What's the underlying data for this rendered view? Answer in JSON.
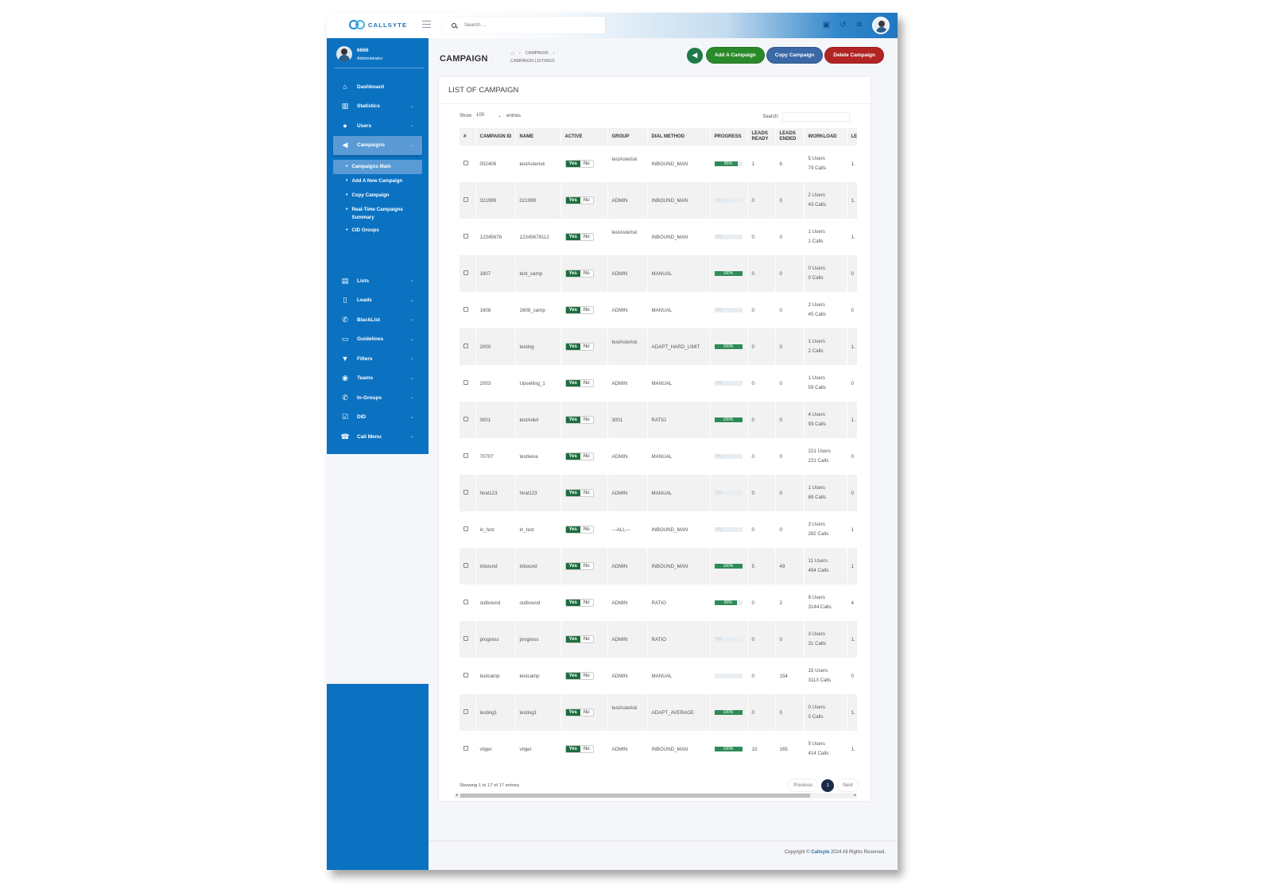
{
  "brand": {
    "logo_text": "CALLSYTE"
  },
  "topbar": {
    "search_placeholder": "Search ..."
  },
  "user": {
    "id": "6666",
    "role": "Administrator"
  },
  "sidebar": {
    "items_top": [
      {
        "label": "Dashboard",
        "icon": "home-icon",
        "glyph": "⌂"
      },
      {
        "label": "Statistics",
        "icon": "chart-icon",
        "glyph": "▥"
      },
      {
        "label": "Users",
        "icon": "user-icon",
        "glyph": "●"
      },
      {
        "label": "Campaigns",
        "icon": "megaphone-icon",
        "glyph": "◀"
      }
    ],
    "campaign_submenu": [
      {
        "label": "Campaigns Main"
      },
      {
        "label": "Add A New Campaign"
      },
      {
        "label": "Copy Campaign"
      },
      {
        "label": "Real-Time Campaigns Summary"
      },
      {
        "label": "CID Groups"
      }
    ],
    "items_bottom": [
      {
        "label": "Lists",
        "icon": "list-icon",
        "glyph": "▤"
      },
      {
        "label": "Leads",
        "icon": "file-icon",
        "glyph": "▯"
      },
      {
        "label": "BlackList",
        "icon": "phone-slash-icon",
        "glyph": "✆"
      },
      {
        "label": "Guidelines",
        "icon": "card-icon",
        "glyph": "▭"
      },
      {
        "label": "Filters",
        "icon": "filter-icon",
        "glyph": "▼"
      },
      {
        "label": "Teams",
        "icon": "users-icon",
        "glyph": "◉"
      },
      {
        "label": "In-Groups",
        "icon": "phone-icon",
        "glyph": "✆"
      },
      {
        "label": "DID",
        "icon": "check-square-icon",
        "glyph": "☑"
      },
      {
        "label": "Call Menu",
        "icon": "phone-volume-icon",
        "glyph": "☎"
      }
    ]
  },
  "header": {
    "title": "CAMPAIGN",
    "breadcrumb_1": "CAMPAIGN",
    "breadcrumb_2": "CAMPAIGN LISTINGS",
    "btn_add": "Add A Campaign",
    "btn_copy": "Copy Campaign",
    "btn_delete": "Delete Campaign"
  },
  "card": {
    "title": "LIST OF CAMPAIGN",
    "show_label": "Show",
    "show_value": "100",
    "entries_label": "entries",
    "search_label": "Search:",
    "info": "Showing 1 to 17 of 17 entries",
    "prev": "Previous",
    "page": "1",
    "next": "Next"
  },
  "table": {
    "columns": [
      "#",
      "CAMPAIGN ID",
      "NAME",
      "ACTIVE",
      "GROUP",
      "DIAL METHOD",
      "PROGRESS",
      "LEADS READY",
      "LEADS ENDED",
      "WORKLOAD",
      "LE"
    ],
    "yes_label": "Yes",
    "no_label": "No",
    "rows": [
      {
        "id": "002406",
        "name": "testAsterisk",
        "group": "testAsterisk",
        "dial": "INBOUND_MAN",
        "progress": 85,
        "ptext": "85%",
        "ready": "1",
        "ended": "6",
        "users": "5 Users",
        "calls": "79 Calls",
        "le": "1."
      },
      {
        "id": "021999",
        "name": "021999",
        "group": "ADMIN",
        "dial": "INBOUND_MAN",
        "progress": 0,
        "ptext": "0%",
        "ready": "0",
        "ended": "0",
        "users": "2 Users",
        "calls": "43 Calls",
        "le": "1."
      },
      {
        "id": "12345678",
        "name": "12345678112",
        "group": "testAsterisk",
        "dial": "INBOUND_MAN",
        "progress": 0,
        "ptext": "0%",
        "ready": "0",
        "ended": "0",
        "users": "1 Users",
        "calls": "1 Calls",
        "le": "1."
      },
      {
        "id": "1607",
        "name": "test_camp",
        "group": "ADMIN",
        "dial": "MANUAL",
        "progress": 100,
        "ptext": "100%",
        "ready": "0",
        "ended": "0",
        "users": "0 Users",
        "calls": "0 Calls",
        "le": "0"
      },
      {
        "id": "1608",
        "name": "1608_camp",
        "group": "ADMIN",
        "dial": "MANUAL",
        "progress": 0,
        "ptext": "0%",
        "ready": "0",
        "ended": "0",
        "users": "2 Users",
        "calls": "45 Calls",
        "le": "0"
      },
      {
        "id": "2000",
        "name": "testing",
        "group": "testAsterisk",
        "dial": "ADAPT_HARD_LIMIT",
        "progress": 100,
        "ptext": "100%",
        "ready": "0",
        "ended": "0",
        "users": "1 Users",
        "calls": "2 Calls",
        "le": "1."
      },
      {
        "id": "2003",
        "name": "Upselling_1",
        "group": "ADMIN",
        "dial": "MANUAL",
        "progress": 0,
        "ptext": "0%",
        "ready": "0",
        "ended": "0",
        "users": "1 Users",
        "calls": "59 Calls",
        "le": "0"
      },
      {
        "id": "3001",
        "name": "testAnkit",
        "group": "3001",
        "dial": "RATIO",
        "progress": 100,
        "ptext": "100%",
        "ready": "0",
        "ended": "0",
        "users": "4 Users",
        "calls": "93 Calls",
        "le": "1."
      },
      {
        "id": "70707",
        "name": "testkeva",
        "group": "ADMIN",
        "dial": "MANUAL",
        "progress": 0,
        "ptext": "0%",
        "ready": "0",
        "ended": "0",
        "users": "221 Users",
        "calls": "221 Calls",
        "le": "0"
      },
      {
        "id": "hiral123",
        "name": "hiral123",
        "group": "ADMIN",
        "dial": "MANUAL",
        "progress": 0,
        "ptext": "0%",
        "ready": "0",
        "ended": "0",
        "users": "1 Users",
        "calls": "89 Calls",
        "le": "0"
      },
      {
        "id": "in_test",
        "name": "in_test",
        "group": "---ALL---",
        "dial": "INBOUND_MAN",
        "progress": 0,
        "ptext": "0%",
        "ready": "0",
        "ended": "0",
        "users": "3 Users",
        "calls": "282 Calls",
        "le": "1"
      },
      {
        "id": "inbound",
        "name": "inbound",
        "group": "ADMIN",
        "dial": "INBOUND_MAN",
        "progress": 100,
        "ptext": "100%",
        "ready": "5",
        "ended": "49",
        "users": "11 Users",
        "calls": "494 Calls",
        "le": "1"
      },
      {
        "id": "outbound",
        "name": "outbound",
        "group": "ADMIN",
        "dial": "RATIO",
        "progress": 80,
        "ptext": "80%",
        "ready": "0",
        "ended": "2",
        "users": "9 Users",
        "calls": "3144 Calls",
        "le": "4"
      },
      {
        "id": "progress",
        "name": "progress",
        "group": "ADMIN",
        "dial": "RATIO",
        "progress": 0,
        "ptext": "0%",
        "ready": "0",
        "ended": "0",
        "users": "3 Users",
        "calls": "31 Calls",
        "le": "1."
      },
      {
        "id": "testcamp",
        "name": "testcamp",
        "group": "ADMIN",
        "dial": "MANUAL",
        "progress": 0,
        "ptext": "",
        "ready": "0",
        "ended": "154",
        "users": "15 Users",
        "calls": "3113 Calls",
        "le": "0"
      },
      {
        "id": "testing1",
        "name": "testing1",
        "group": "testAsterisk",
        "dial": "ADAPT_AVERAGE",
        "progress": 100,
        "ptext": "100%",
        "ready": "0",
        "ended": "0",
        "users": "0 Users",
        "calls": "0 Calls",
        "le": "1."
      },
      {
        "id": "vtiger",
        "name": "vtiger",
        "group": "ADMIN",
        "dial": "INBOUND_MAN",
        "progress": 100,
        "ptext": "100%",
        "ready": "10",
        "ended": "165",
        "users": "5 Users",
        "calls": "414 Calls",
        "le": "1."
      }
    ]
  },
  "footer": {
    "prefix": "Copyright ©",
    "brand": "Callsyte",
    "suffix": "2024 All Rights Reserved."
  },
  "colors": {
    "sidebar": "#0b72c2",
    "active": "#5a9bd6",
    "yes": "#1c6e3e",
    "progress": "#2e8b57",
    "add": "#2a8a2a",
    "copy": "#3b68a6",
    "delete": "#b22424"
  }
}
